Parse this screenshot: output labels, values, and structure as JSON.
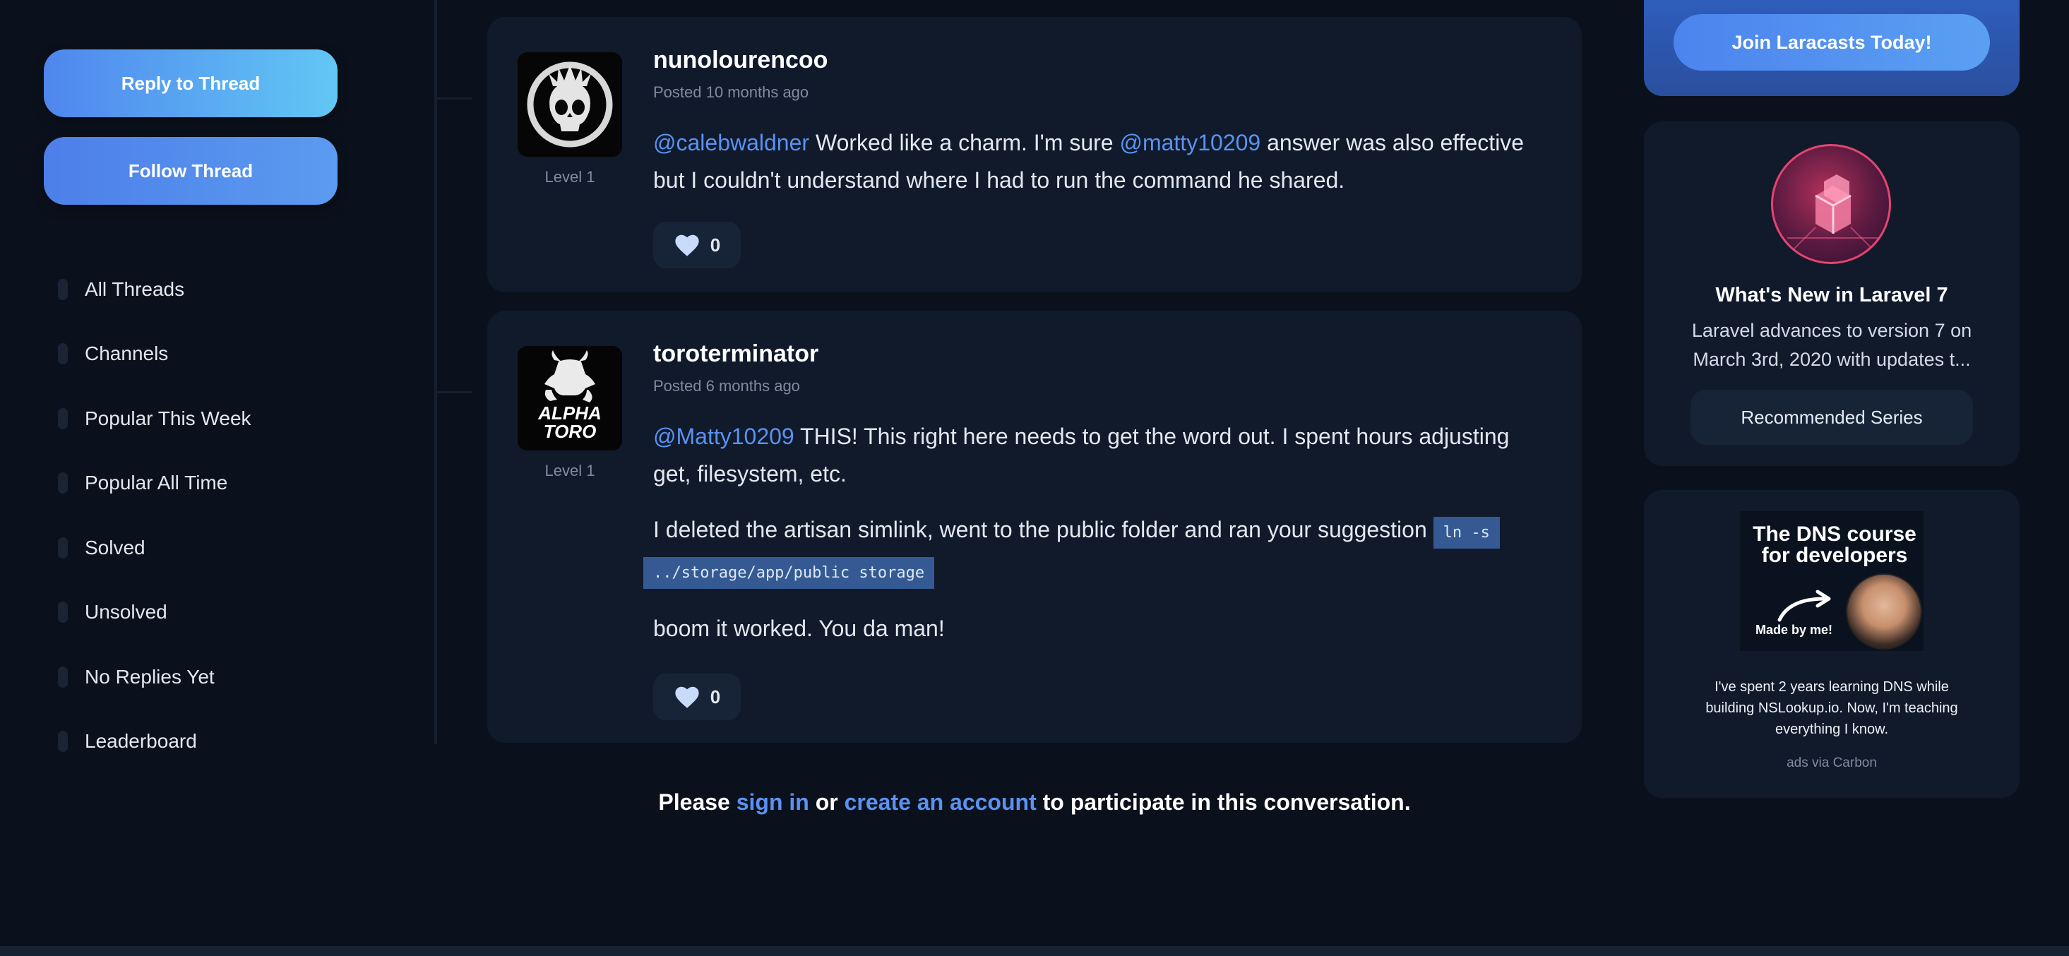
{
  "sidebar": {
    "reply_button": "Reply to Thread",
    "follow_button": "Follow Thread",
    "nav": [
      {
        "label": "All Threads"
      },
      {
        "label": "Channels"
      },
      {
        "label": "Popular This Week"
      },
      {
        "label": "Popular All Time"
      },
      {
        "label": "Solved"
      },
      {
        "label": "Unsolved"
      },
      {
        "label": "No Replies Yet"
      },
      {
        "label": "Leaderboard"
      }
    ]
  },
  "posts": [
    {
      "author": "nunolourencoo",
      "posted": "Posted 10 months ago",
      "level": "Level 1",
      "mention1": "@calebwaldner",
      "text1": " Worked like a charm. I'm sure ",
      "mention2": "@matty10209",
      "text2": " answer was also effective but I couldn't understand where I had to run the command he shared.",
      "likes": "0"
    },
    {
      "author": "toroterminator",
      "posted": "Posted 6 months ago",
      "level": "Level 1",
      "avatar_text_line1": "ALPHA",
      "avatar_text_line2": "TORO",
      "mention1": "@Matty10209",
      "text1": " THIS! This right here needs to get the word out. I spent hours adjusting get, filesystem, etc.",
      "para2": "I deleted the artisan simlink, went to the public folder and ran your suggestion ",
      "code_line1": "ln -s",
      "code_line2": "../storage/app/public storage",
      "para3": "boom it worked. You da man!",
      "likes": "0"
    }
  ],
  "cta": {
    "prefix": "Please ",
    "sign_in": "sign in",
    "middle": " or ",
    "create_account": "create an account",
    "suffix": " to participate in this conversation."
  },
  "right": {
    "join_button": "Join Laracasts Today!",
    "series_title": "What's New in Laravel 7",
    "series_desc": "Laravel advances to version 7 on March 3rd, 2020 with updates t...",
    "series_button": "Recommended Series",
    "ad_heading": "The DNS course for developers",
    "ad_made": "Made by me!",
    "ad_text": "I've spent 2 years learning DNS while building NSLookup.io. Now, I'm teaching everything I know.",
    "ad_via": "ads via Carbon"
  },
  "colors": {
    "background": "#0b111c",
    "card": "#101a2b",
    "accent": "#5a92f2"
  }
}
